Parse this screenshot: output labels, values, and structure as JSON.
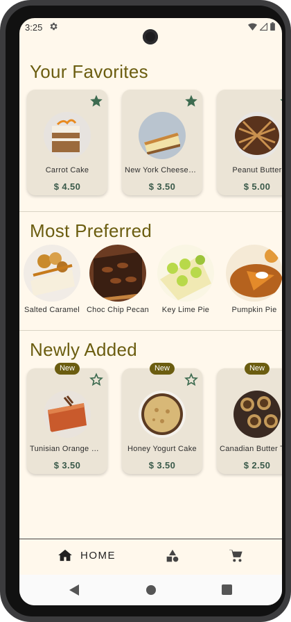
{
  "status_bar": {
    "time": "3:25"
  },
  "sections": {
    "favorites": {
      "title": "Your Favorites",
      "items": [
        {
          "name": "Carrot Cake",
          "price": "$ 4.50",
          "favorited": true
        },
        {
          "name": "New York Cheesecake",
          "price": "$ 3.50",
          "favorited": true
        },
        {
          "name": "Peanut Butter",
          "price": "$ 5.00",
          "favorited": true
        }
      ]
    },
    "preferred": {
      "title": "Most Preferred",
      "items": [
        {
          "name": "Salted Caramel"
        },
        {
          "name": "Choc Chip Pecan"
        },
        {
          "name": "Key Lime Pie"
        },
        {
          "name": "Pumpkin Pie"
        }
      ]
    },
    "newly_added": {
      "title": "Newly Added",
      "badge": "New",
      "items": [
        {
          "name": "Tunisian Orange Cake",
          "price": "$ 3.50",
          "favorited": false
        },
        {
          "name": "Honey Yogurt Cake",
          "price": "$ 3.50",
          "favorited": false
        },
        {
          "name": "Canadian Butter Tarts",
          "price": "$ 2.50",
          "favorited": false
        }
      ]
    }
  },
  "bottom_nav": {
    "home_label": "HOME"
  },
  "colors": {
    "accent": "#6b5d10",
    "price": "#3a5a4a",
    "card": "#ebe4d6",
    "background": "#fff8ec"
  }
}
